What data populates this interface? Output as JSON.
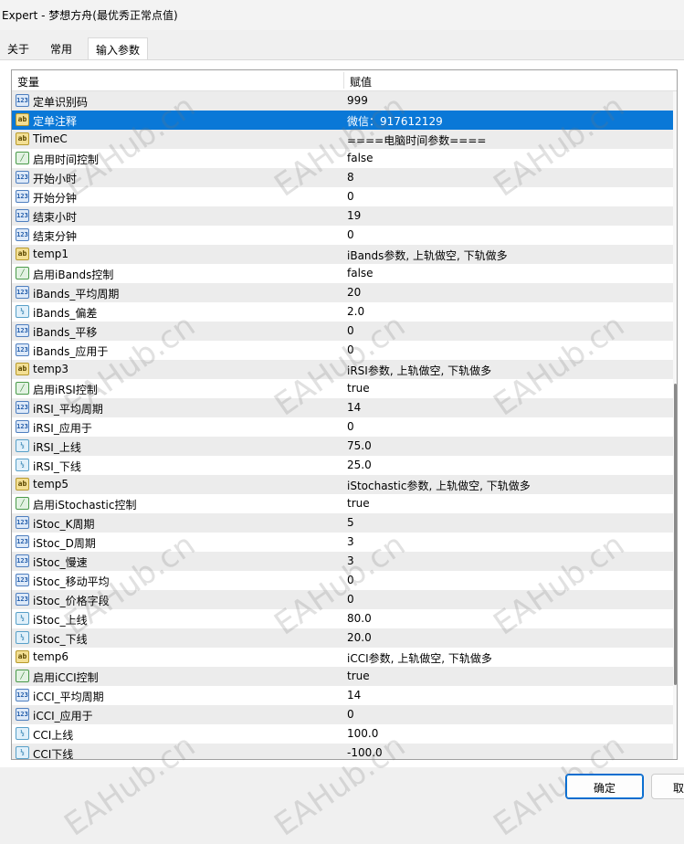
{
  "window": {
    "title": "Expert - 梦想方舟(最优秀正常点值)"
  },
  "tabs": [
    {
      "label": "关于",
      "active": false
    },
    {
      "label": "常用",
      "active": false
    },
    {
      "label": "输入参数",
      "active": true
    }
  ],
  "grid": {
    "col_variable": "变量",
    "col_value": "赋值",
    "selected_index": 1,
    "rows": [
      {
        "type": "int",
        "icon": "integer-icon",
        "name": "定单识别码",
        "value": "999"
      },
      {
        "type": "ab",
        "icon": "string-icon",
        "name": "定单注释",
        "value": "微信：917612129"
      },
      {
        "type": "ab",
        "icon": "string-icon",
        "name": "TimeC",
        "value": "====电脑时间参数===="
      },
      {
        "type": "bool",
        "icon": "bool-icon",
        "name": "启用时间控制",
        "value": "false"
      },
      {
        "type": "int",
        "icon": "integer-icon",
        "name": "开始小时",
        "value": "8"
      },
      {
        "type": "int",
        "icon": "integer-icon",
        "name": "开始分钟",
        "value": "0"
      },
      {
        "type": "int",
        "icon": "integer-icon",
        "name": "结束小时",
        "value": "19"
      },
      {
        "type": "int",
        "icon": "integer-icon",
        "name": "结束分钟",
        "value": "0"
      },
      {
        "type": "ab",
        "icon": "string-icon",
        "name": "temp1",
        "value": "iBands参数, 上轨做空, 下轨做多"
      },
      {
        "type": "bool",
        "icon": "bool-icon",
        "name": "启用iBands控制",
        "value": "false"
      },
      {
        "type": "int",
        "icon": "integer-icon",
        "name": "iBands_平均周期",
        "value": "20"
      },
      {
        "type": "dbl",
        "icon": "double-icon",
        "name": "iBands_偏差",
        "value": "2.0"
      },
      {
        "type": "int",
        "icon": "integer-icon",
        "name": "iBands_平移",
        "value": "0"
      },
      {
        "type": "int",
        "icon": "integer-icon",
        "name": "iBands_应用于",
        "value": "0"
      },
      {
        "type": "ab",
        "icon": "string-icon",
        "name": "temp3",
        "value": "iRSI参数, 上轨做空, 下轨做多"
      },
      {
        "type": "bool",
        "icon": "bool-icon",
        "name": "启用iRSI控制",
        "value": "true"
      },
      {
        "type": "int",
        "icon": "integer-icon",
        "name": "iRSI_平均周期",
        "value": "14"
      },
      {
        "type": "int",
        "icon": "integer-icon",
        "name": "iRSI_应用于",
        "value": "0"
      },
      {
        "type": "dbl",
        "icon": "double-icon",
        "name": "iRSI_上线",
        "value": "75.0"
      },
      {
        "type": "dbl",
        "icon": "double-icon",
        "name": "iRSI_下线",
        "value": "25.0"
      },
      {
        "type": "ab",
        "icon": "string-icon",
        "name": "temp5",
        "value": "iStochastic参数, 上轨做空, 下轨做多"
      },
      {
        "type": "bool",
        "icon": "bool-icon",
        "name": "启用iStochastic控制",
        "value": "true"
      },
      {
        "type": "int",
        "icon": "integer-icon",
        "name": "iStoc_K周期",
        "value": "5"
      },
      {
        "type": "int",
        "icon": "integer-icon",
        "name": "iStoc_D周期",
        "value": "3"
      },
      {
        "type": "int",
        "icon": "integer-icon",
        "name": "iStoc_慢速",
        "value": "3"
      },
      {
        "type": "int",
        "icon": "integer-icon",
        "name": "iStoc_移动平均",
        "value": "0"
      },
      {
        "type": "int",
        "icon": "integer-icon",
        "name": "iStoc_价格字段",
        "value": "0"
      },
      {
        "type": "dbl",
        "icon": "double-icon",
        "name": "iStoc_上线",
        "value": "80.0"
      },
      {
        "type": "dbl",
        "icon": "double-icon",
        "name": "iStoc_下线",
        "value": "20.0"
      },
      {
        "type": "ab",
        "icon": "string-icon",
        "name": "temp6",
        "value": "iCCI参数, 上轨做空, 下轨做多"
      },
      {
        "type": "bool",
        "icon": "bool-icon",
        "name": "启用iCCI控制",
        "value": "true"
      },
      {
        "type": "int",
        "icon": "integer-icon",
        "name": "iCCI_平均周期",
        "value": "14"
      },
      {
        "type": "int",
        "icon": "integer-icon",
        "name": "iCCI_应用于",
        "value": "0"
      },
      {
        "type": "dbl",
        "icon": "double-icon",
        "name": "CCI上线",
        "value": "100.0"
      },
      {
        "type": "dbl",
        "icon": "double-icon",
        "name": "CCI下线",
        "value": "-100.0"
      }
    ]
  },
  "icon_glyphs": {
    "int": "123",
    "ab": "ab",
    "bool": "╱",
    "dbl": "½"
  },
  "watermark": "EAHub.cn",
  "buttons": {
    "ok_label": "确定",
    "cancel_label": "取"
  },
  "colors": {
    "selection": "#0a78d7",
    "odd_row": "#ececec"
  }
}
